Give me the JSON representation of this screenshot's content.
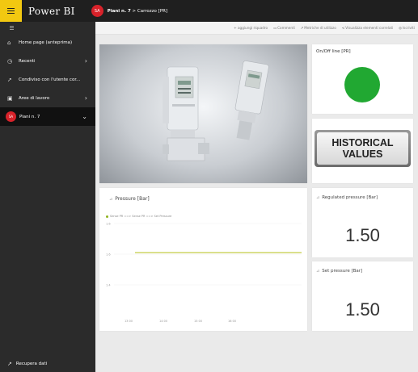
{
  "app": {
    "name": "Power BI"
  },
  "header": {
    "avatar_initials": "SA",
    "breadcrumb_workspace": "Piani n. 7",
    "breadcrumb_separator": ">",
    "breadcrumb_item": "Carrozzo [PR]"
  },
  "sidebar": {
    "items": [
      {
        "label": "Home page (anteprima)",
        "icon": "home-icon"
      },
      {
        "label": "Recenti",
        "icon": "clock-icon"
      },
      {
        "label": "Condiviso con l'utente cor...",
        "icon": "share-icon"
      },
      {
        "label": "Aree di lavoro",
        "icon": "workspaces-icon"
      },
      {
        "label": "Piani n. 7",
        "icon": "workspace-avatar",
        "initials": "SA"
      }
    ],
    "bottom_label": "Recupera dati"
  },
  "actions": [
    {
      "label": "+ aggiungi riquadro"
    },
    {
      "label": "Commenti"
    },
    {
      "label": "Metriche di utilizzo"
    },
    {
      "label": "Visualizza elementi correlati"
    },
    {
      "label": "Iscriviti"
    }
  ],
  "tiles": {
    "onoff_title": "On/Off line [PR]",
    "status_color": "#21a832",
    "historical_line1": "HISTORICAL",
    "historical_line2": "VALUES",
    "regulated_title": "Regulated pressure [Bar]",
    "regulated_value": "1.50",
    "set_title": "Set pressure [Bar]",
    "set_value": "1.50"
  },
  "chart_data": {
    "type": "line",
    "title": "Pressure [Bar]",
    "legend": [
      "Sense PR ==> Sense PR ==> Set Pressure"
    ],
    "y_ticks": [
      "1.6",
      "1.6",
      "1.4"
    ],
    "x_ticks": [
      "13:00",
      "14:00",
      "15:00",
      "16:00"
    ],
    "ylim": [
      1.4,
      1.6
    ],
    "series": [
      {
        "name": "Sense PR ==> Sense PR ==> Set Pressure",
        "x": [
          "13:00",
          "16:00"
        ],
        "values": [
          1.5,
          1.5
        ],
        "color": "#b6c11a"
      }
    ]
  }
}
